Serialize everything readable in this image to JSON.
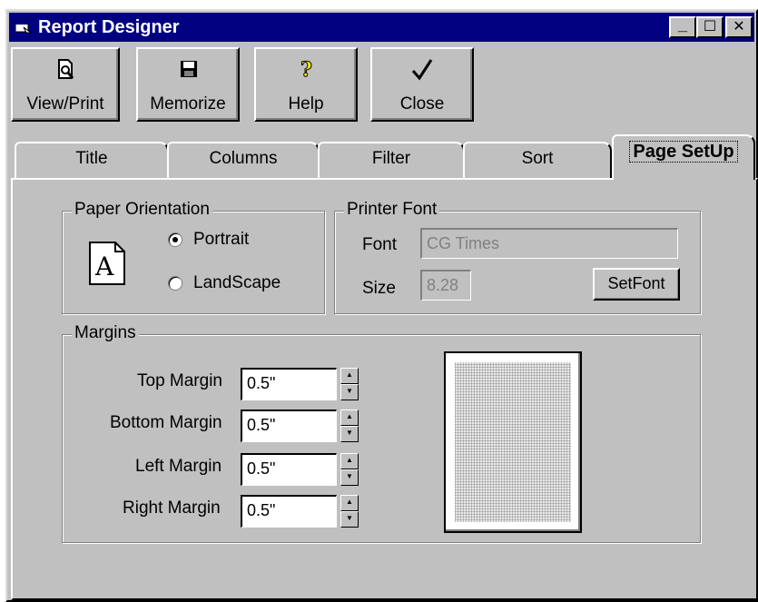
{
  "window": {
    "title": "Report Designer",
    "minimize": "_",
    "maximize": "☐",
    "close": "✕"
  },
  "toolbar": [
    {
      "label": "View/Print",
      "icon": "print-preview-icon"
    },
    {
      "label": "Memorize",
      "icon": "floppy-disk-icon"
    },
    {
      "label": "Help",
      "icon": "help-icon"
    },
    {
      "label": "Close",
      "icon": "checkmark-icon"
    }
  ],
  "tabs": [
    "Title",
    "Columns",
    "Filter",
    "Sort",
    "Page SetUp"
  ],
  "active_tab": "Page SetUp",
  "paper_orientation": {
    "label": "Paper Orientation",
    "icon_letter": "A",
    "options": [
      {
        "label": "Portrait",
        "checked": true
      },
      {
        "label": "LandScape",
        "checked": false
      }
    ]
  },
  "printer_font": {
    "label": "Printer Font",
    "font_label": "Font",
    "font_value": "CG Times",
    "size_label": "Size",
    "size_value": "8.28",
    "set_font_button": "SetFont"
  },
  "margins": {
    "label": "Margins",
    "rows": [
      {
        "label": "Top Margin",
        "value": "0.5\""
      },
      {
        "label": "Bottom Margin",
        "value": "0.5\""
      },
      {
        "label": "Left Margin",
        "value": "0.5\""
      },
      {
        "label": "Right Margin",
        "value": "0.5\""
      }
    ]
  }
}
